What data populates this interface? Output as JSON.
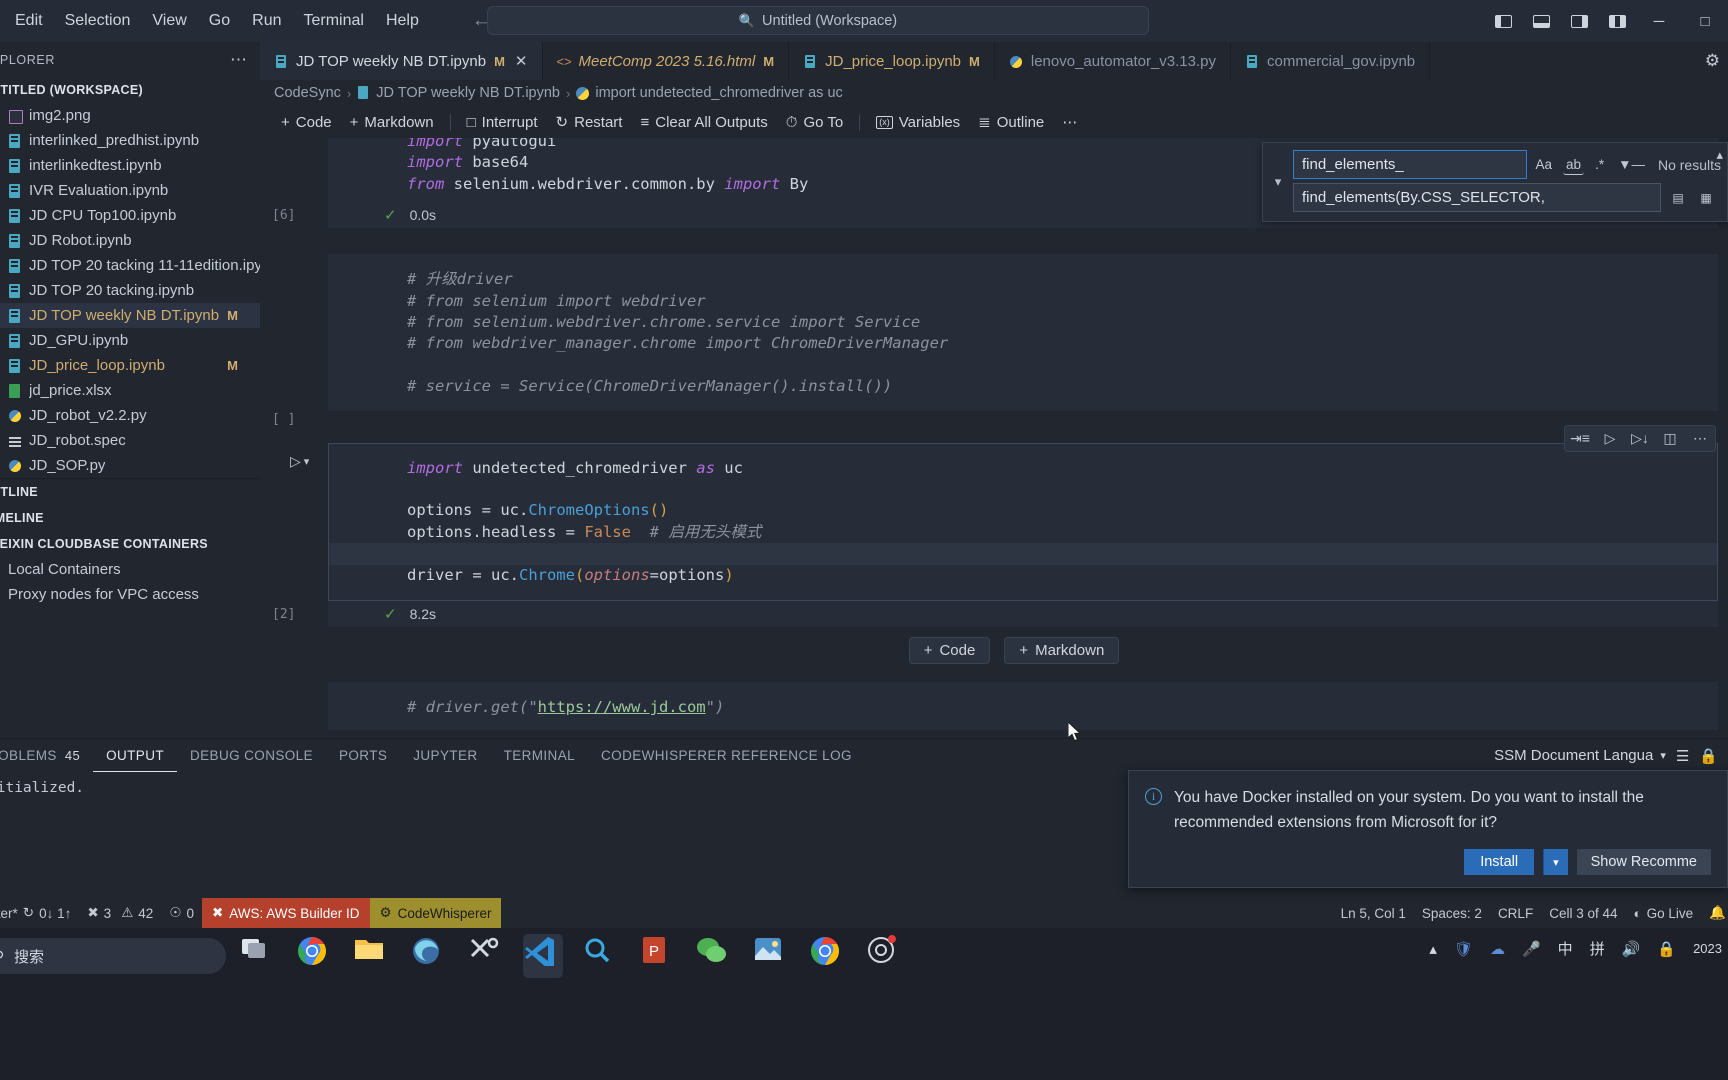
{
  "titlebar": {
    "menu": [
      "Edit",
      "Selection",
      "View",
      "Go",
      "Run",
      "Terminal",
      "Help"
    ],
    "back_icon": "arrow-left-icon",
    "forward_icon": "arrow-right-icon",
    "command_center": "Untitled (Workspace)",
    "search_icon": "search-icon",
    "layout_icons": [
      "toggle-primary-sidebar-icon",
      "toggle-panel-icon",
      "toggle-secondary-sidebar-icon",
      "customize-layout-icon"
    ],
    "window_controls": [
      "minimize",
      "maximize",
      "close"
    ]
  },
  "sidebar": {
    "header": "XPLORER",
    "more_icon": "ellipsis-icon",
    "workspace": "NTITLED (WORKSPACE)",
    "files": [
      {
        "name": "img2.png",
        "icon": "png",
        "modified": ""
      },
      {
        "name": "interlinked_predhist.ipynb",
        "icon": "nb",
        "modified": ""
      },
      {
        "name": "interlinkedtest.ipynb",
        "icon": "nb",
        "modified": ""
      },
      {
        "name": "IVR Evaluation.ipynb",
        "icon": "nb",
        "modified": ""
      },
      {
        "name": "JD CPU Top100.ipynb",
        "icon": "nb",
        "modified": ""
      },
      {
        "name": "JD Robot.ipynb",
        "icon": "nb",
        "modified": ""
      },
      {
        "name": "JD TOP 20 tacking 11-11edition.ipynb",
        "icon": "nb",
        "modified": ""
      },
      {
        "name": "JD TOP 20 tacking.ipynb",
        "icon": "nb",
        "modified": ""
      },
      {
        "name": "JD TOP weekly NB DT.ipynb",
        "icon": "nb",
        "modified": "M"
      },
      {
        "name": "JD_GPU.ipynb",
        "icon": "nb",
        "modified": ""
      },
      {
        "name": "JD_price_loop.ipynb",
        "icon": "nb",
        "modified": "M"
      },
      {
        "name": "jd_price.xlsx",
        "icon": "xlsx",
        "modified": ""
      },
      {
        "name": "JD_robot_v2.2.py",
        "icon": "py",
        "modified": ""
      },
      {
        "name": "JD_robot.spec",
        "icon": "spec",
        "modified": ""
      },
      {
        "name": "JD_SOP.py",
        "icon": "py",
        "modified": ""
      }
    ],
    "sections": [
      "UTLINE",
      "IMELINE",
      "VEIXIN CLOUDBASE CONTAINERS"
    ],
    "containers": [
      "Local Containers",
      "Proxy nodes for VPC access"
    ]
  },
  "tabs": [
    {
      "label": "JD TOP weekly NB DT.ipynb",
      "icon": "nb",
      "modified": "M",
      "active": true,
      "italic": false,
      "close": "✕"
    },
    {
      "label": "MeetComp 2023 5.16.html",
      "icon": "html",
      "modified": "M",
      "active": false,
      "italic": true
    },
    {
      "label": "JD_price_loop.ipynb",
      "icon": "nb",
      "modified": "M",
      "active": false,
      "italic": false
    },
    {
      "label": "lenovo_automator_v3.13.py",
      "icon": "py",
      "modified": "",
      "active": false,
      "italic": false
    },
    {
      "label": "commercial_gov.ipynb",
      "icon": "nb",
      "modified": "",
      "active": false,
      "italic": false
    }
  ],
  "tabs_right": {
    "settings_icon": "gear-icon"
  },
  "breadcrumb": {
    "root": "CodeSync",
    "file": "JD TOP weekly NB DT.ipynb",
    "symbol": "import undetected_chromedriver as uc",
    "separator": "›"
  },
  "notebook_toolbar": {
    "code": "Code",
    "markdown": "Markdown",
    "interrupt": "Interrupt",
    "restart": "Restart",
    "clear_all_outputs": "Clear All Outputs",
    "goto": "Go To",
    "variables": "Variables",
    "outline": "Outline",
    "more": "⋯"
  },
  "find_widget": {
    "query": "find_elements_",
    "replace": "find_elements(By.CSS_SELECTOR,",
    "match_case_icon": "Aa",
    "whole_word_icon": "ab",
    "regex_icon": ".*",
    "filter_icon": "filter-icon",
    "result_count": "No results",
    "toggle_icon": "chevron-down-icon",
    "replace_icon": "replace-icon",
    "replace_all_icon": "replace-all-icon",
    "close_icon": "close-icon"
  },
  "cells": [
    {
      "exec_count": "[6]",
      "lines": [
        [
          {
            "t": "import",
            "c": "kw"
          },
          {
            "t": " pyautogui",
            "c": ""
          }
        ],
        [
          {
            "t": "import",
            "c": "kw"
          },
          {
            "t": " base64",
            "c": ""
          }
        ],
        [
          {
            "t": "from",
            "c": "kw"
          },
          {
            "t": " selenium.webdriver.common.by ",
            "c": ""
          },
          {
            "t": "import",
            "c": "kw"
          },
          {
            "t": " By",
            "c": ""
          }
        ]
      ],
      "status_check": "✓",
      "status_time": "0.0s"
    },
    {
      "exec_count": "[ ]",
      "lines": [
        [
          {
            "t": "# 升级driver",
            "c": "cm"
          }
        ],
        [
          {
            "t": "# from selenium import webdriver",
            "c": "cm"
          }
        ],
        [
          {
            "t": "# from selenium.webdriver.chrome.service import Service",
            "c": "cm"
          }
        ],
        [
          {
            "t": "# from webdriver_manager.chrome import ChromeDriverManager",
            "c": "cm"
          }
        ],
        [
          {
            "t": "",
            "c": ""
          }
        ],
        [
          {
            "t": "# service = Service(ChromeDriverManager().install())",
            "c": "cm"
          }
        ]
      ],
      "status_check": "",
      "status_time": ""
    },
    {
      "exec_count": "[2]",
      "run_icon": "run-cell-icon",
      "chevron_icon": "chevron-down-icon",
      "lines": [
        [
          {
            "t": "import",
            "c": "kw"
          },
          {
            "t": " undetected_chromedriver ",
            "c": ""
          },
          {
            "t": "as",
            "c": "kw"
          },
          {
            "t": " uc",
            "c": ""
          }
        ],
        [
          {
            "t": "",
            "c": ""
          }
        ],
        [
          {
            "t": "options = uc.",
            "c": ""
          },
          {
            "t": "ChromeOptions",
            "c": "fn"
          },
          {
            "t": "()",
            "c": "par"
          }
        ],
        [
          {
            "t": "options.headless = ",
            "c": ""
          },
          {
            "t": "False",
            "c": "num"
          },
          {
            "t": "  ",
            "c": ""
          },
          {
            "t": "# 启用无头模式",
            "c": "cm"
          }
        ],
        [
          {
            "t": "",
            "c": "",
            "highlight": true
          }
        ],
        [
          {
            "t": "driver = uc.",
            "c": ""
          },
          {
            "t": "Chrome",
            "c": "fn"
          },
          {
            "t": "(",
            "c": "par"
          },
          {
            "t": "options",
            "c": "arg"
          },
          {
            "t": "=options",
            "c": ""
          },
          {
            "t": ")",
            "c": "par"
          }
        ]
      ],
      "status_check": "✓",
      "status_time": "8.2s",
      "toolbar_icons": [
        "run-above-icon",
        "run-cell-icon",
        "run-below-icon",
        "split-cell-icon",
        "more-icon"
      ]
    },
    {
      "exec_count": "",
      "lines": [
        [
          {
            "t": "# driver.get(\"",
            "c": "cm"
          },
          {
            "t": "https://www.jd.com",
            "c": "lnk"
          },
          {
            "t": "\")",
            "c": "cm"
          }
        ]
      ],
      "status_check": "",
      "status_time": ""
    }
  ],
  "add_cell_buttons": {
    "code": "Code",
    "markdown": "Markdown",
    "plus": "+"
  },
  "panel": {
    "tabs": [
      {
        "label": "ROBLEMS",
        "count": "45",
        "active": false
      },
      {
        "label": "OUTPUT",
        "count": "",
        "active": true
      },
      {
        "label": "DEBUG CONSOLE",
        "count": "",
        "active": false
      },
      {
        "label": "PORTS",
        "count": "",
        "active": false
      },
      {
        "label": "JUPYTER",
        "count": "",
        "active": false
      },
      {
        "label": "TERMINAL",
        "count": "",
        "active": false
      },
      {
        "label": "CODEWHISPERER REFERENCE LOG",
        "count": "",
        "active": false
      }
    ],
    "output_text": "nitialized.",
    "language_select": "SSM Document Langua",
    "chevron_icon": "chevron-down-icon",
    "clear_icon": "clear-output-icon",
    "lock_icon": "lock-icon"
  },
  "notification": {
    "icon": "info-icon",
    "message": "You have Docker installed on your system. Do you want to install the recommended extensions from Microsoft for it?",
    "install_button": "Install",
    "install_caret": "⌄",
    "show_recommend_button": "Show Recomme"
  },
  "statusbar": {
    "branch": "ster*",
    "sync_icon": "sync-icon",
    "sync_counts": "0↓ 1↑",
    "errors_icon": "error-icon",
    "errors": "3",
    "warnings_icon": "warning-icon",
    "warnings": "42",
    "ports_icon": "ports-icon",
    "ports": "0",
    "aws_icon": "aws-error-icon",
    "aws": "AWS: AWS Builder ID",
    "codewhisperer_icon": "codewhisperer-icon",
    "codewhisperer": "CodeWhisperer",
    "cursor_position": "Ln 5, Col 1",
    "spaces": "Spaces: 2",
    "eol": "CRLF",
    "cell_info": "Cell 3 of 44",
    "golive_icon": "broadcast-icon",
    "golive": "Go Live",
    "bell_icon": "bell-icon"
  },
  "taskbar": {
    "search_placeholder": "搜索",
    "search_icon": "search-icon",
    "apps": [
      "task-view-icon",
      "chrome-icon",
      "file-explorer-icon",
      "edge-icon",
      "tools-icon",
      "vscode-icon",
      "everything-search-icon",
      "powerpoint-icon",
      "wechat-icon",
      "photos-icon",
      "chrome-icon-2",
      "meeting-icon"
    ],
    "tray": [
      "chevron-up-icon",
      "shield-icon",
      "onedrive-icon",
      "mic-icon"
    ],
    "ime": "中",
    "ime_mode": "拼",
    "volume_icon": "volume-icon",
    "clock": "2023"
  }
}
